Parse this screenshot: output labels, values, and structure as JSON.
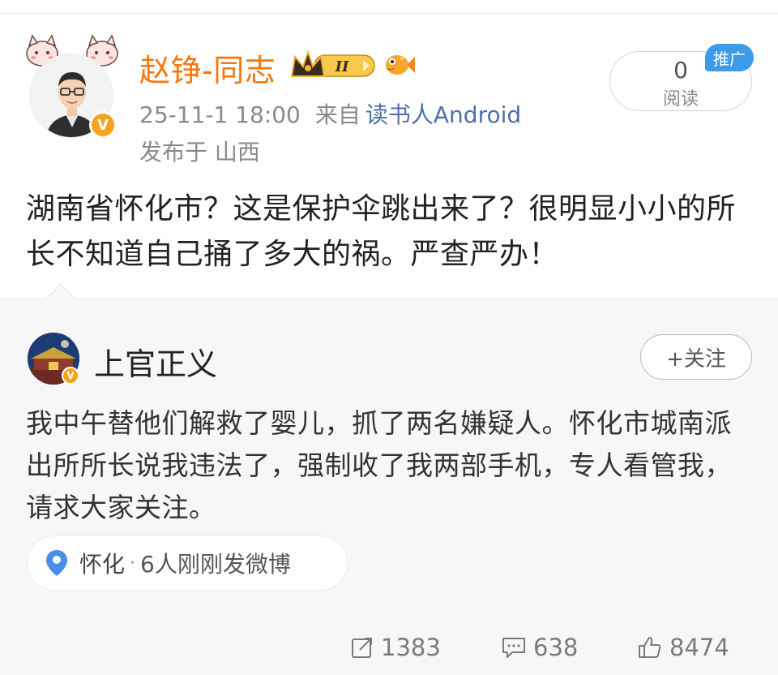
{
  "post": {
    "author_name": "赵铮-同志",
    "level_badge": "II",
    "timestamp": "25-11-1 18:00",
    "from_label": "来自",
    "source": "读书人Android",
    "location": "发布于 山西",
    "read_count": "0",
    "read_label": "阅读",
    "promo_label": "推广",
    "text": "湖南省怀化市？这是保护伞跳出来了？很明显小小的所长不知道自己捅了多大的祸。严查严办！"
  },
  "repost": {
    "author_name": "上官正义",
    "follow_label": "+关注",
    "text": "我中午替他们解救了婴儿，抓了两名嫌疑人。怀化市城南派出所所长说我违法了，强制收了我两部手机，专人看管我，请求大家关注。",
    "location_place": "怀化",
    "location_separator": "·",
    "location_activity": "6人刚刚发微博",
    "actions": {
      "reposts": "1383",
      "comments": "638",
      "likes": "8474"
    }
  },
  "colors": {
    "author_name": "#f5770e",
    "source_link": "#4d6fa8",
    "promo_badge": "#3d9be9",
    "verified_badge": "#f7a21c",
    "repost_background": "#f7f7f7"
  },
  "icons": [
    "cat-sticker-icon",
    "crown-level-icon",
    "fish-badge-icon",
    "verified-v-icon",
    "location-pin-icon",
    "repost-icon",
    "comment-icon",
    "like-icon"
  ]
}
